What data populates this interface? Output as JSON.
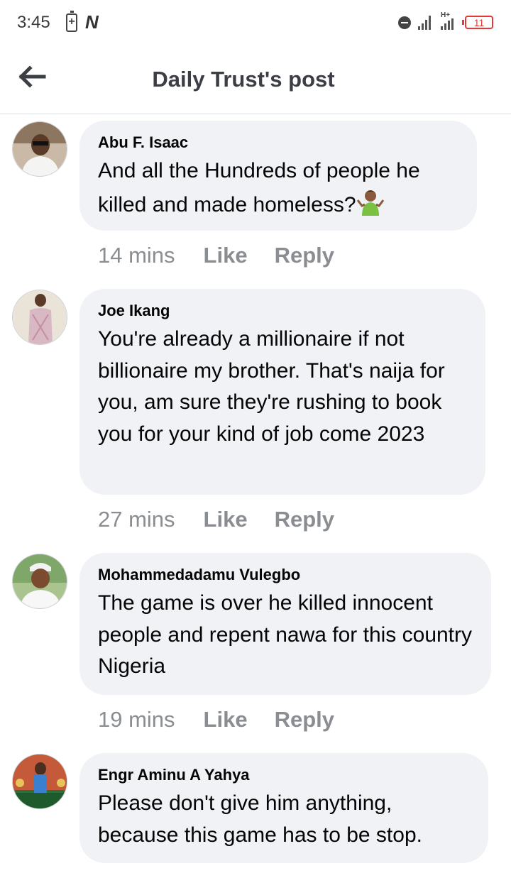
{
  "status_bar": {
    "time": "3:45",
    "battery_saver_label": "+",
    "n_icon": "N",
    "signal_label": "H+",
    "battery_level": "11"
  },
  "header": {
    "title": "Daily Trust's post",
    "back_icon": "arrow-left-icon"
  },
  "comments": [
    {
      "author": "Abu F. Isaac",
      "text": "And all the Hundreds of people he killed and made homeless?",
      "emoji": "person-shrugging-emoji",
      "time": "14 mins",
      "like": "Like",
      "reply": "Reply"
    },
    {
      "author": "Joe Ikang",
      "text": "You're already a millionaire if not billionaire my brother. That's naija for you, am sure they're rushing to book you for your kind of job come 2023",
      "time": "27 mins",
      "like": "Like",
      "reply": "Reply"
    },
    {
      "author": "Mohammedadamu Vulegbo",
      "text": "The game is over he killed innocent people and repent nawa for this country Nigeria",
      "time": "19 mins",
      "like": "Like",
      "reply": "Reply"
    },
    {
      "author": "Engr Aminu A Yahya",
      "text": "Please don't give him anything, because this game has to be stop."
    }
  ],
  "colors": {
    "bubble": "#f0f2f5",
    "meta_text": "#8a8d91",
    "battery_low": "#e53935"
  }
}
